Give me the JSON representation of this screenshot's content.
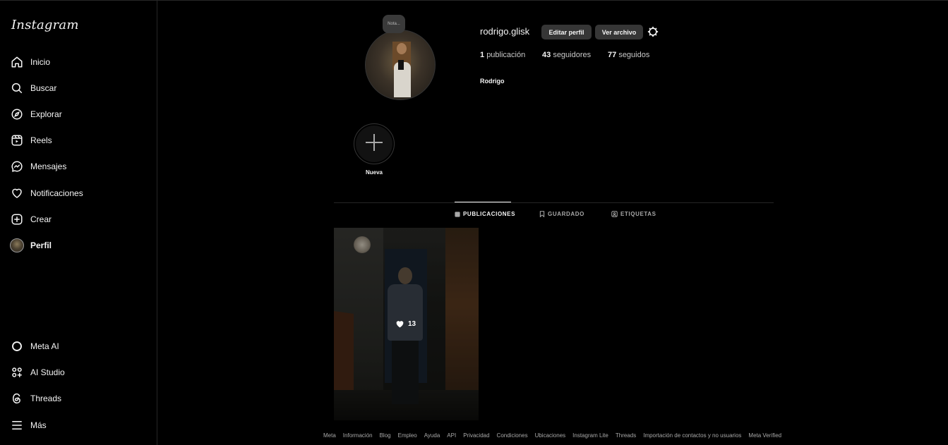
{
  "sidebar": {
    "logo": "Instagram",
    "items": [
      {
        "label": "Inicio",
        "icon": "home-icon"
      },
      {
        "label": "Buscar",
        "icon": "search-icon"
      },
      {
        "label": "Explorar",
        "icon": "compass-icon"
      },
      {
        "label": "Reels",
        "icon": "reels-icon"
      },
      {
        "label": "Mensajes",
        "icon": "messenger-icon"
      },
      {
        "label": "Notificaciones",
        "icon": "heart-icon"
      },
      {
        "label": "Crear",
        "icon": "plus-square-icon"
      },
      {
        "label": "Perfil",
        "icon": "avatar"
      }
    ],
    "bottom_items": [
      {
        "label": "Meta AI",
        "icon": "meta-ai-icon"
      },
      {
        "label": "AI Studio",
        "icon": "ai-studio-icon"
      },
      {
        "label": "Threads",
        "icon": "threads-icon"
      },
      {
        "label": "Más",
        "icon": "menu-icon"
      }
    ]
  },
  "profile": {
    "note": "Nota...",
    "username": "rodrigo.glisk",
    "edit_button": "Editar perfil",
    "archive_button": "Ver archivo",
    "stats": {
      "posts_count": "1",
      "posts_label": "publicación",
      "followers_count": "43",
      "followers_label": "seguidores",
      "following_count": "77",
      "following_label": "seguidos"
    },
    "full_name": "Rodrigo",
    "new_highlight_label": "Nueva"
  },
  "tabs": [
    {
      "label": "PUBLICACIONES",
      "active": true,
      "icon": "grid-icon"
    },
    {
      "label": "GUARDADO",
      "active": false,
      "icon": "bookmark-icon"
    },
    {
      "label": "ETIQUETAS",
      "active": false,
      "icon": "tag-icon"
    }
  ],
  "posts": [
    {
      "likes": "13"
    }
  ],
  "footer": [
    "Meta",
    "Información",
    "Blog",
    "Empleo",
    "Ayuda",
    "API",
    "Privacidad",
    "Condiciones",
    "Ubicaciones",
    "Instagram Lite",
    "Threads",
    "Importación de contactos y no usuarios",
    "Meta Verified"
  ],
  "colors": {
    "background": "#000000",
    "button": "#363636",
    "text": "#f5f5f5",
    "muted": "#a8a8a8"
  }
}
